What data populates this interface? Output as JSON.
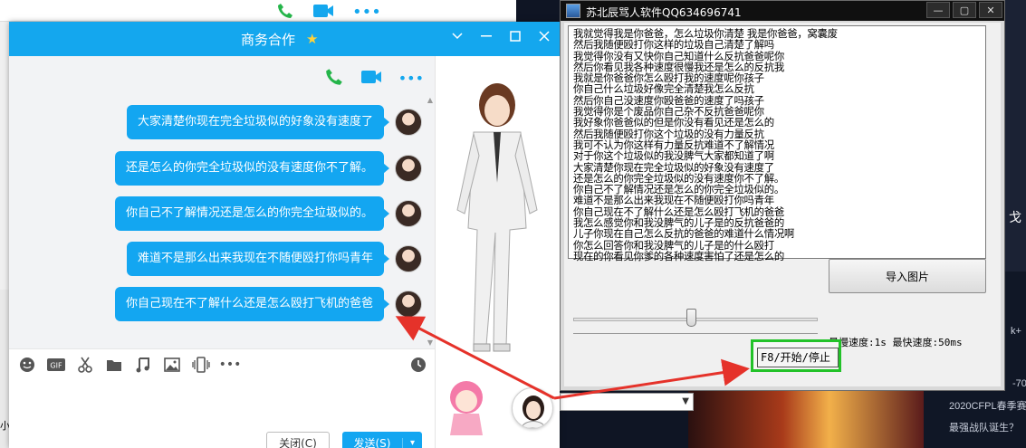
{
  "background": {
    "side_items": [
      "2020CFPL春季赛",
      "最强战队诞生？",
      "-70",
      "k+"
    ],
    "right_strip_text": "戈",
    "left_fragment_text": "小"
  },
  "qq_window": {
    "title": "商务合作",
    "title_badge": "★",
    "messages": [
      "大家清楚你现在完全垃圾似的好象没有速度了",
      "还是怎么的你完全垃圾似的没有速度你不了解。",
      "你自己不了解情况还是怎么的你完全垃圾似的。",
      "难道不是那么出来我现在不随便殴打你吗青年",
      "你自己现在不了解什么还是怎么殴打飞机的爸爸"
    ],
    "close_button": "关闭(C)",
    "send_button": "发送(S)",
    "send_dropdown": "▾"
  },
  "tool_window": {
    "title": "苏北辰骂人软件QQ634696741",
    "text_lines": [
      "我就觉得我是你爸爸，怎么垃圾你清楚 我是你爸爸，窝囊废",
      "然后我随便殴打你这样的垃圾自己清楚了解吗",
      "我觉得你没有又快你自己知道什么反抗爸爸呢你",
      "然后你看见我各种速度很慢我还是怎么的反抗我",
      "我就是你爸爸你怎么殴打我的速度呢你孩子",
      "你自己什么垃圾好像完全清楚我怎么反抗",
      "然后你自己没速度你殴爸爸的速度了吗孩子",
      "我觉得你是个废品你自己杂不反抗爸爸呢你",
      "我好象你爸爸似的但是你没有看见还是怎么的",
      "然后我随便殴打你这个垃圾的没有力量反抗",
      "我可不认为你这样有力量反抗难道不了解情况",
      "对于你这个垃圾似的我没脾气大家都知道了啊",
      "大家清楚你现在完全垃圾似的好象没有速度了",
      "还是怎么的你完全垃圾似的没有速度你不了解。",
      "你自己不了解情况还是怎么的你完全垃圾似的。",
      "难道不是那么出来我现在不随便殴打你吗青年",
      "你自己现在不了解什么还是怎么殴打飞机的爸爸",
      "我怎么感觉你和我没脾气的儿子是的反抗爸爸的",
      "儿子你现在自己怎么反抗的爸爸的难道什么情况啊",
      "你怎么回答你和我没脾气的儿子是的什么殴打",
      "现在的你看见你爹的各种速度害怕了还是怎么的"
    ],
    "import_button": "导入图片",
    "speed_label": "最慢速度:1s 最快速度:50ms",
    "slider_value": 0.48,
    "hotkey_label": "F8/开始/停止"
  },
  "colors": {
    "qq_blue": "#14a7ee",
    "bubble_blue": "#13a6f1",
    "highlight_green": "#22c229",
    "arrow_red": "#e5322a"
  }
}
